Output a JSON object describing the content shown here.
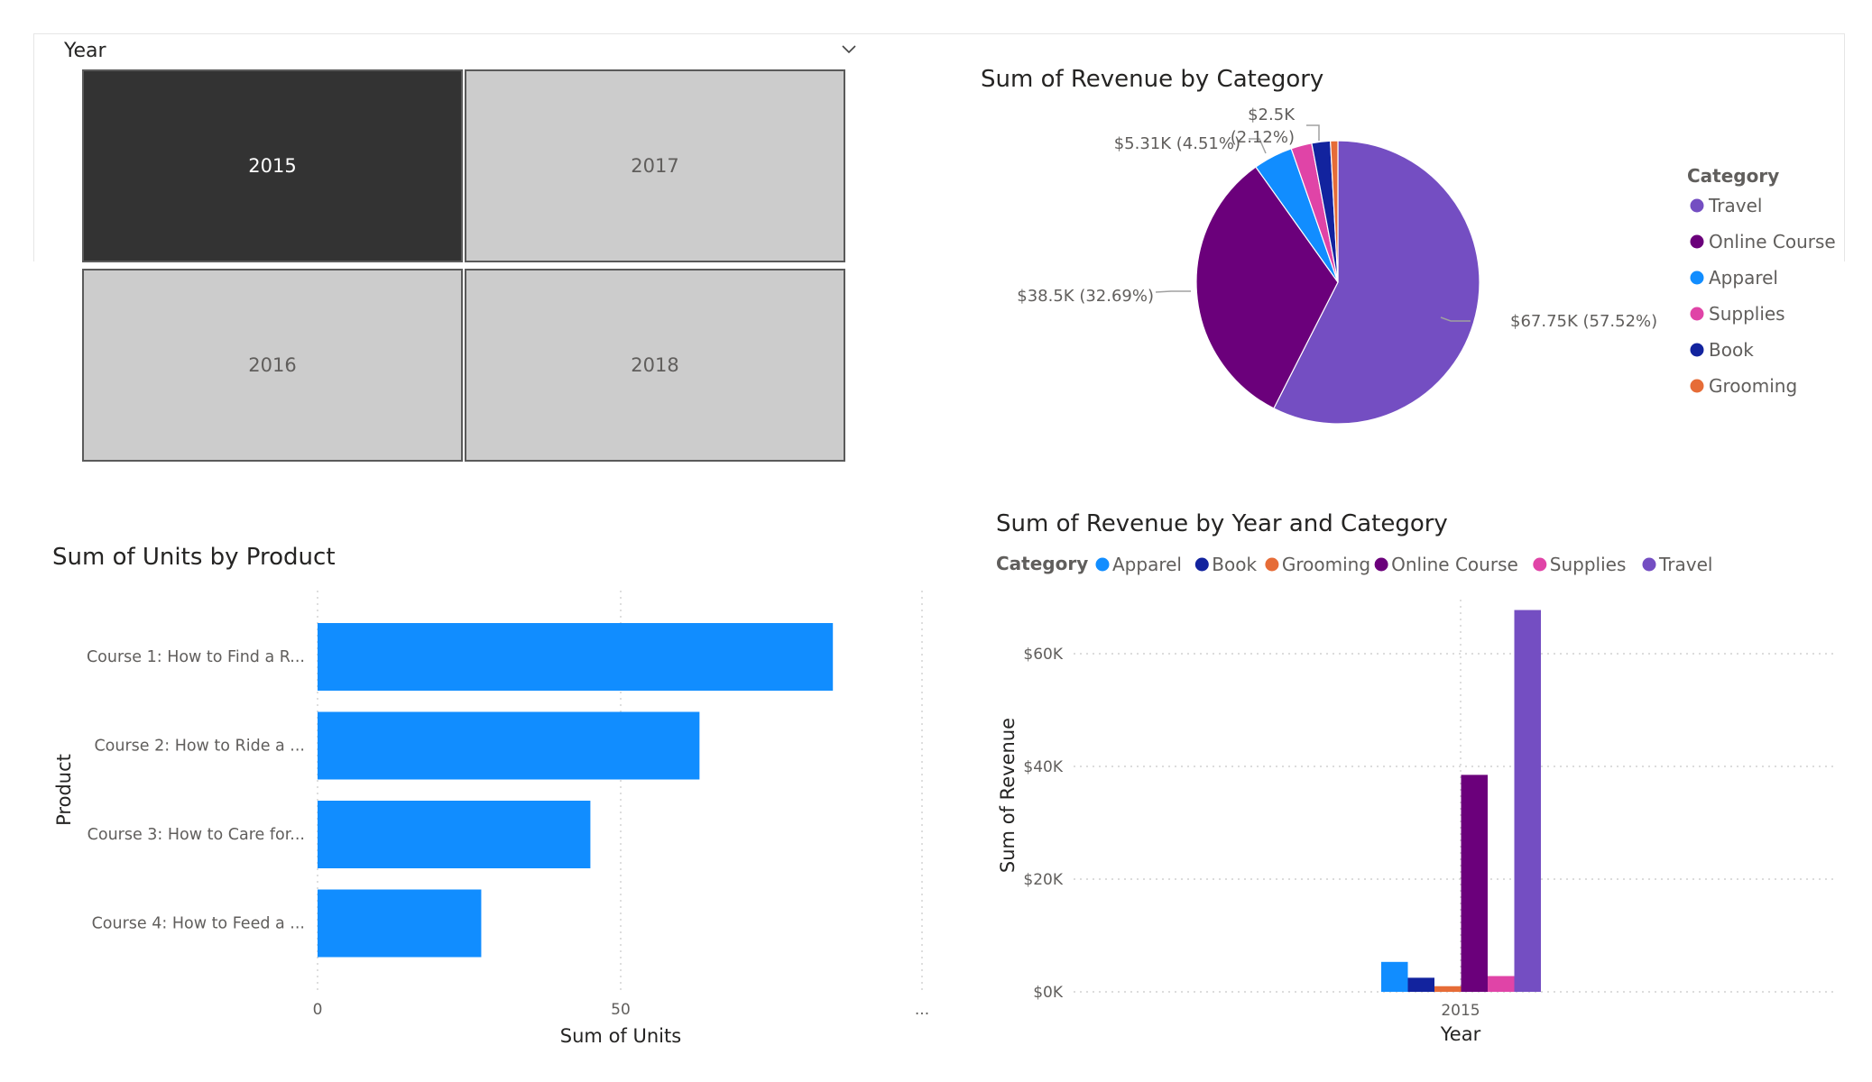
{
  "slicer": {
    "title": "Year",
    "tiles": [
      {
        "label": "2015",
        "selected": true
      },
      {
        "label": "2017",
        "selected": false
      },
      {
        "label": "2016",
        "selected": false
      },
      {
        "label": "2018",
        "selected": false
      }
    ],
    "dropdown_icon": "chevron-down-icon"
  },
  "colors": {
    "Apparel": "#118dff",
    "Book": "#12239e",
    "Grooming": "#e66c37",
    "Online Course": "#6b007b",
    "Supplies": "#e044a7",
    "Travel": "#744ec2",
    "selected_tile": "#333333",
    "tile": "#cccccc"
  },
  "pie": {
    "title": "Sum of Revenue by Category",
    "legend_title": "Category",
    "labels": [
      {
        "category": "Travel",
        "text": "$67.75K (57.52%)"
      },
      {
        "category": "Online Course",
        "text": "$38.5K (32.69%)"
      },
      {
        "category": "Apparel",
        "text": "$5.31K (4.51%)"
      },
      {
        "category": "Book",
        "text": "$2.5K"
      },
      {
        "category": "Book",
        "text": "(2.12%)"
      }
    ]
  },
  "bar": {
    "title": "Sum of Units by Product",
    "ylabel": "Product",
    "xlabel": "Sum of Units",
    "ticks": [
      "0",
      "50",
      "..."
    ]
  },
  "column": {
    "title": "Sum of Revenue by Year and Category",
    "legend_title": "Category",
    "ylabel": "Sum of Revenue",
    "xlabel": "Year",
    "yticks": [
      "$0K",
      "$20K",
      "$40K",
      "$60K"
    ]
  },
  "chart_data": [
    {
      "type": "pie",
      "title": "Sum of Revenue by Category",
      "categories": [
        "Travel",
        "Online Course",
        "Apparel",
        "Supplies",
        "Book",
        "Grooming"
      ],
      "legend_order": [
        "Travel",
        "Online Course",
        "Apparel",
        "Supplies",
        "Book",
        "Grooming"
      ],
      "values": [
        67750,
        38500,
        5310,
        2800,
        2500,
        1000
      ],
      "legend": "right"
    },
    {
      "type": "bar",
      "orientation": "horizontal",
      "title": "Sum of Units by Product",
      "categories": [
        "Course 1: How to Find a R...",
        "Course 2: How to Ride a ...",
        "Course 3: How to Care for...",
        "Course 4: How to Feed a ..."
      ],
      "values": [
        85,
        63,
        45,
        27
      ],
      "xlabel": "Sum of Units",
      "ylabel": "Product",
      "xlim": [
        0,
        100
      ],
      "grid": true,
      "color": "#118dff"
    },
    {
      "type": "bar",
      "title": "Sum of Revenue by Year and Category",
      "categories": [
        "2015"
      ],
      "series": [
        {
          "name": "Apparel",
          "values": [
            5310
          ]
        },
        {
          "name": "Book",
          "values": [
            2500
          ]
        },
        {
          "name": "Grooming",
          "values": [
            1000
          ]
        },
        {
          "name": "Online Course",
          "values": [
            38500
          ]
        },
        {
          "name": "Supplies",
          "values": [
            2800
          ]
        },
        {
          "name": "Travel",
          "values": [
            67750
          ]
        }
      ],
      "xlabel": "Year",
      "ylabel": "Sum of Revenue",
      "ylim": [
        0,
        68000
      ],
      "grid": true,
      "legend": "top-left"
    }
  ]
}
